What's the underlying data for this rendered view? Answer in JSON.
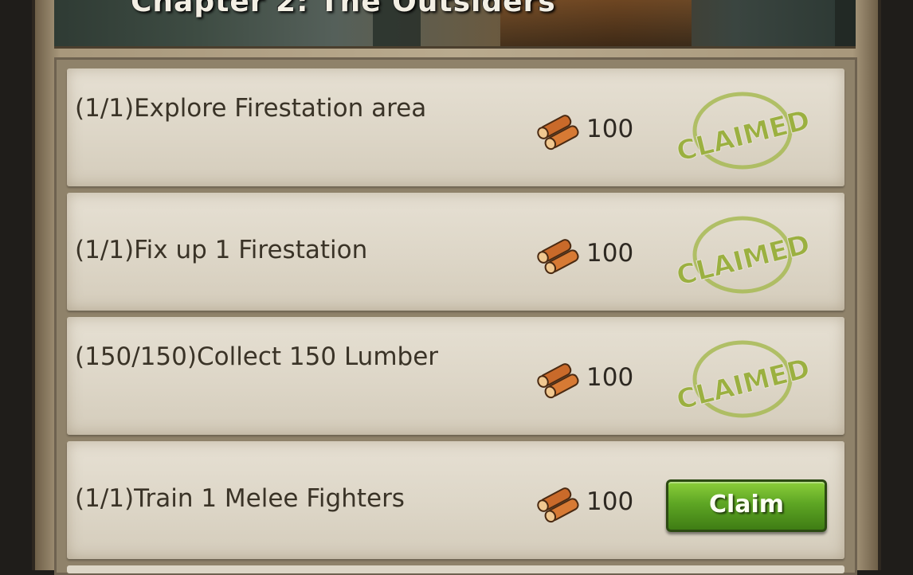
{
  "chapter_title": "Chapter 2: The Outsiders",
  "quests": [
    {
      "task": "(1/1)Explore Firestation area",
      "reward_icon": "lumber-icon",
      "reward": "100",
      "status": "claimed",
      "status_label": "CLAIMED"
    },
    {
      "task": "(1/1)Fix up 1 Firestation",
      "reward_icon": "lumber-icon",
      "reward": "100",
      "status": "claimed",
      "status_label": "CLAIMED"
    },
    {
      "task": "(150/150)Collect 150 Lumber",
      "reward_icon": "lumber-icon",
      "reward": "100",
      "status": "claimed",
      "status_label": "CLAIMED"
    },
    {
      "task": "(1/1)Train 1 Melee Fighters",
      "reward_icon": "lumber-icon",
      "reward": "100",
      "status": "claimable",
      "button_label": "Claim"
    }
  ],
  "colors": {
    "stamp_green": "#a4b84c",
    "claim_button": "#5ea624",
    "row_background": "#ddd6c7"
  }
}
